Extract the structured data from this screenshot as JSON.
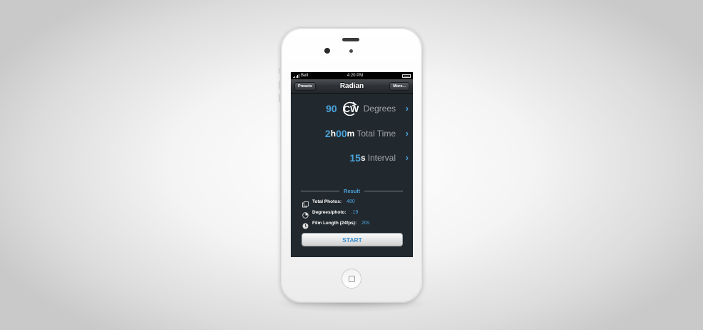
{
  "status_bar": {
    "carrier": "Bell",
    "time": "4:20 PM"
  },
  "nav": {
    "title": "Radian",
    "left_button": "Presets",
    "right_button": "More..."
  },
  "settings": {
    "degrees": {
      "value": "90",
      "direction": "CW",
      "label": "Degrees"
    },
    "total_time": {
      "hours": "2",
      "h_unit": "h",
      "minutes": "00",
      "m_unit": "m",
      "label": "Total Time"
    },
    "interval": {
      "value": "15",
      "unit": "s",
      "label": "Interval"
    }
  },
  "result": {
    "header": "Result",
    "rows": [
      {
        "label": "Total Photos:",
        "value": "480",
        "icon": "photos-icon"
      },
      {
        "label": "Degrees/photo:",
        "value": ".19",
        "icon": "angle-icon"
      },
      {
        "label": "Film Length (24fps):",
        "value": "20s",
        "icon": "clock-icon"
      }
    ]
  },
  "start_button": "START",
  "colors": {
    "accent": "#4aa3dc",
    "screen_bg": "#22292e"
  }
}
